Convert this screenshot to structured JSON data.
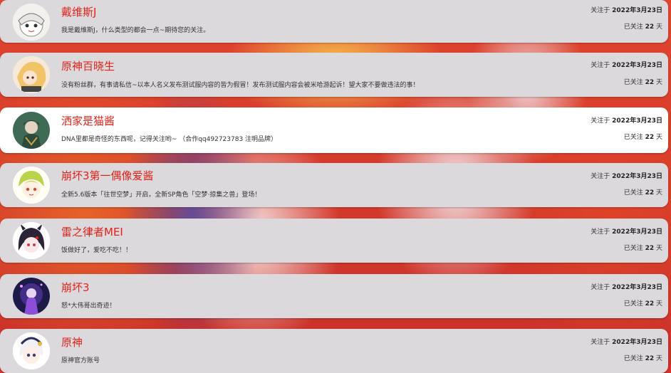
{
  "follow_since_prefix": "关注于",
  "follow_days_prefix": "已关注",
  "follow_days_suffix": "天",
  "accent_color": "#e2231a",
  "users": [
    {
      "name": "戴维斯J",
      "desc": "我是戴维斯J，什么类型的都会一点~期待您的关注。",
      "date": "2022年3月23日",
      "days": "22",
      "avatar_icon": "avatar-chibi-white-hair"
    },
    {
      "name": "原神百晓生",
      "desc": "没有粉丝群，有事请私信~以本人名义发布测试服内容的皆为假冒！发布测试服内容会被米哈游起诉！望大家不要做违法的事！",
      "date": "2022年3月23日",
      "days": "22",
      "avatar_icon": "avatar-blonde-character"
    },
    {
      "name": "洒家是猫酱",
      "desc": "DNA里都是奇怪的东西呢，记得关注哟~ （合作qq492723783 注明品牌）",
      "date": "2022年3月23日",
      "days": "22",
      "avatar_icon": "avatar-green-character"
    },
    {
      "name": "崩坏3第一偶像爱酱",
      "desc": "全新5.6版本「往世空梦」开启，全新SP角色「空梦·掠集之兽」登场！",
      "date": "2022年3月23日",
      "days": "22",
      "avatar_icon": "avatar-green-hair-chibi"
    },
    {
      "name": "雷之律者MEI",
      "desc": "饭做好了，爱吃不吃！！",
      "date": "2022年3月23日",
      "days": "22",
      "avatar_icon": "avatar-dark-hair-horns"
    },
    {
      "name": "崩坏3",
      "desc": "怒*大伟哥出奇迹！",
      "date": "2022年3月23日",
      "days": "22",
      "avatar_icon": "avatar-purple-glow"
    },
    {
      "name": "原神",
      "desc": "原神官方账号",
      "date": "2022年3月23日",
      "days": "22",
      "avatar_icon": "avatar-paimon"
    }
  ]
}
